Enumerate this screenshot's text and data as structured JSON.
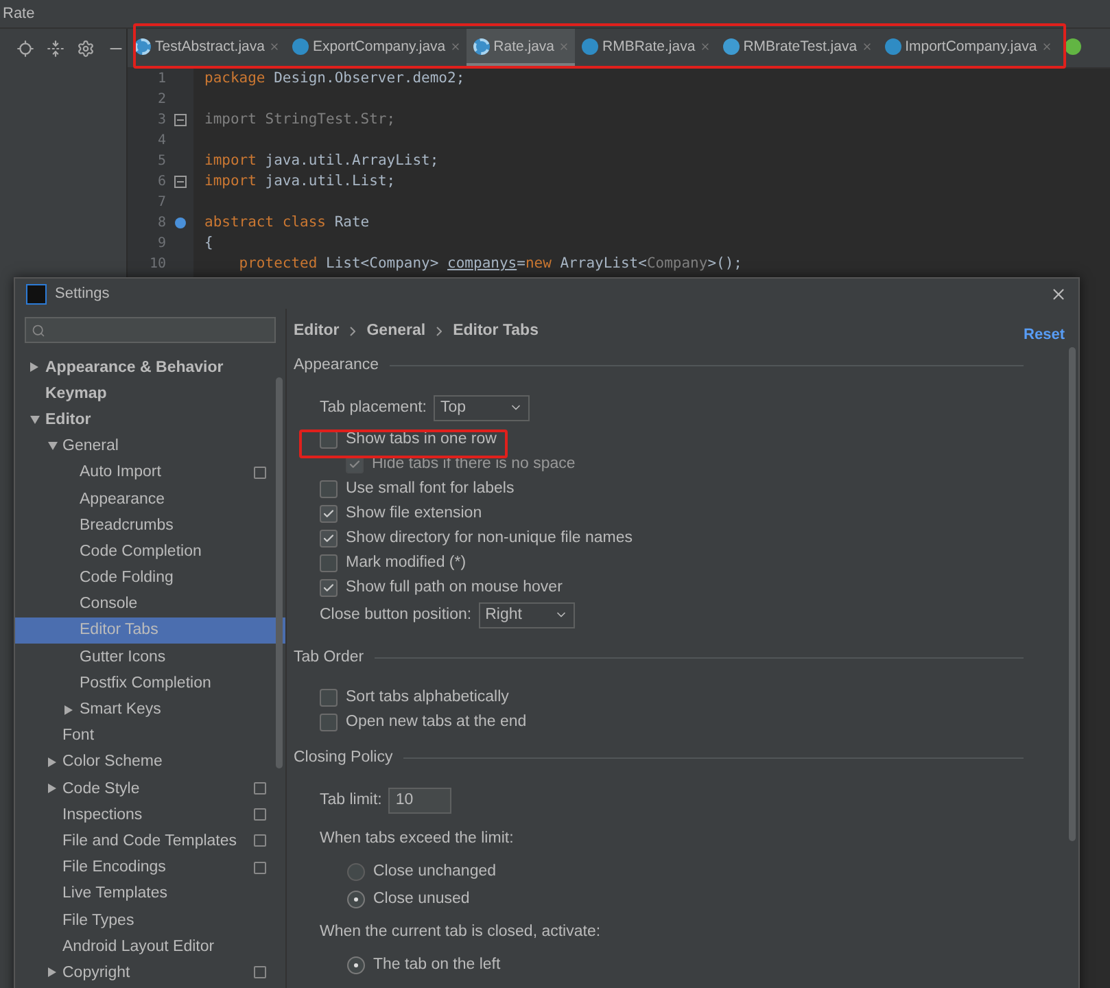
{
  "window": {
    "title": "Rate"
  },
  "editor_tabs": [
    {
      "label": "TestAbstract.java",
      "kind": "abstract",
      "selected": false
    },
    {
      "label": "ExportCompany.java",
      "kind": "class",
      "selected": false
    },
    {
      "label": "Rate.java",
      "kind": "abstract",
      "selected": true
    },
    {
      "label": "RMBRate.java",
      "kind": "class",
      "selected": false
    },
    {
      "label": "RMBrateTest.java",
      "kind": "test",
      "selected": false
    },
    {
      "label": "ImportCompany.java",
      "kind": "class",
      "selected": false
    }
  ],
  "code": [
    {
      "number": "1",
      "tokens": [
        {
          "text": "package ",
          "kind": "keyword"
        },
        {
          "text": "Design.Observer.demo2;",
          "kind": "plain"
        }
      ]
    },
    {
      "number": "2"
    },
    {
      "number": "3",
      "fold": true,
      "tokens": [
        {
          "text": "import StringTest.Str;",
          "kind": "unused"
        }
      ]
    },
    {
      "number": "4"
    },
    {
      "number": "5",
      "tokens": [
        {
          "text": "import ",
          "kind": "keyword"
        },
        {
          "text": "java.util.ArrayList;",
          "kind": "plain"
        }
      ]
    },
    {
      "number": "6",
      "fold": true,
      "tokens": [
        {
          "text": "import ",
          "kind": "keyword"
        },
        {
          "text": "java.util.List;",
          "kind": "plain"
        }
      ]
    },
    {
      "number": "7"
    },
    {
      "number": "8",
      "marker": true,
      "tokens": [
        {
          "text": "abstract class ",
          "kind": "keyword"
        },
        {
          "text": "Rate",
          "kind": "plain"
        }
      ]
    },
    {
      "number": "9",
      "tokens": [
        {
          "text": "{",
          "kind": "plain"
        }
      ]
    },
    {
      "number": "10",
      "tokens": [
        {
          "text": "    protected ",
          "kind": "keyword"
        },
        {
          "text": "List<Company> ",
          "kind": "plain"
        },
        {
          "text": "companys",
          "kind": "field"
        },
        {
          "text": "=",
          "kind": "plain"
        },
        {
          "text": "new ",
          "kind": "keyword"
        },
        {
          "text": "ArrayList<",
          "kind": "plain"
        },
        {
          "text": "Company",
          "kind": "unused"
        },
        {
          "text": ">();",
          "kind": "plain"
        }
      ]
    }
  ],
  "dialog": {
    "title": "Settings",
    "sidebar": [
      {
        "label": "Appearance & Behavior",
        "expanded": false,
        "selected": false
      },
      {
        "label": "Keymap",
        "selected": false
      },
      {
        "label": "Editor",
        "expanded": true,
        "selected": false,
        "children": [
          {
            "label": "General",
            "expanded": true,
            "selected": false,
            "children": [
              {
                "label": "Auto Import",
                "project_scope": true,
                "selected": false
              },
              {
                "label": "Appearance",
                "selected": false
              },
              {
                "label": "Breadcrumbs",
                "selected": false
              },
              {
                "label": "Code Completion",
                "selected": false
              },
              {
                "label": "Code Folding",
                "selected": false
              },
              {
                "label": "Console",
                "selected": false
              },
              {
                "label": "Editor Tabs",
                "selected": true
              },
              {
                "label": "Gutter Icons",
                "selected": false
              },
              {
                "label": "Postfix Completion",
                "selected": false
              },
              {
                "label": "Smart Keys",
                "expanded": false,
                "selected": false
              }
            ]
          },
          {
            "label": "Font",
            "selected": false
          },
          {
            "label": "Color Scheme",
            "expanded": false,
            "selected": false
          },
          {
            "label": "Code Style",
            "expanded": false,
            "project_scope": true,
            "selected": false
          },
          {
            "label": "Inspections",
            "project_scope": true,
            "selected": false
          },
          {
            "label": "File and Code Templates",
            "project_scope": true,
            "selected": false
          },
          {
            "label": "File Encodings",
            "project_scope": true,
            "selected": false
          },
          {
            "label": "Live Templates",
            "selected": false
          },
          {
            "label": "File Types",
            "selected": false
          },
          {
            "label": "Android Layout Editor",
            "selected": false
          },
          {
            "label": "Copyright",
            "expanded": false,
            "project_scope": true,
            "selected": false
          }
        ]
      }
    ],
    "breadcrumb": [
      "Editor",
      "General",
      "Editor Tabs"
    ],
    "reset": "Reset",
    "sections": [
      {
        "title": "Appearance",
        "items": [
          {
            "kind": "dropdown",
            "label": "Tab placement:",
            "value": "Top"
          },
          {
            "kind": "checkbox",
            "label": "Show tabs in one row",
            "checked": false,
            "disabled": false,
            "children": [
              {
                "kind": "checkbox",
                "label": "Hide tabs if there is no space",
                "checked": true,
                "disabled": true
              }
            ]
          },
          {
            "kind": "checkbox",
            "label": "Use small font for labels",
            "checked": false,
            "disabled": false
          },
          {
            "kind": "checkbox",
            "label": "Show file extension",
            "checked": true,
            "disabled": false
          },
          {
            "kind": "checkbox",
            "label": "Show directory for non-unique file names",
            "checked": true,
            "disabled": false
          },
          {
            "kind": "checkbox",
            "label": "Mark modified (*)",
            "checked": false,
            "disabled": false
          },
          {
            "kind": "checkbox",
            "label": "Show full path on mouse hover",
            "checked": true,
            "disabled": false
          },
          {
            "kind": "dropdown",
            "label": "Close button position:",
            "value": "Right"
          }
        ]
      },
      {
        "title": "Tab Order",
        "items": [
          {
            "kind": "checkbox",
            "label": "Sort tabs alphabetically",
            "checked": false,
            "disabled": false
          },
          {
            "kind": "checkbox",
            "label": "Open new tabs at the end",
            "checked": false,
            "disabled": false
          }
        ]
      },
      {
        "title": "Closing Policy",
        "items": [
          {
            "kind": "text-field",
            "label": "Tab limit:",
            "value": "10"
          },
          {
            "kind": "radio-group",
            "label": "When tabs exceed the limit:",
            "options": [
              {
                "label": "Close unchanged",
                "selected": false
              },
              {
                "label": "Close unused",
                "selected": true
              }
            ]
          },
          {
            "kind": "radio-group",
            "label": "When the current tab is closed, activate:",
            "options": [
              {
                "label": "The tab on the left",
                "selected": true
              }
            ]
          }
        ]
      }
    ]
  }
}
